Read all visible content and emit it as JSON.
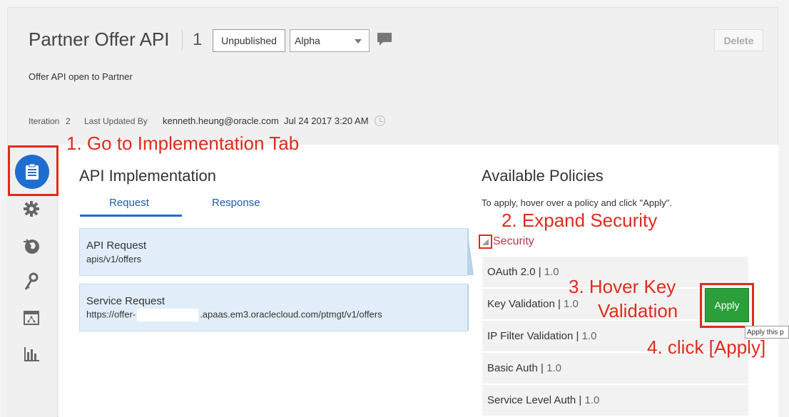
{
  "header": {
    "title": "Partner Offer API",
    "version": "1",
    "status_button": "Unpublished",
    "stage_select": "Alpha",
    "delete_label": "Delete",
    "description": "Offer API open to Partner",
    "iteration_label": "Iteration",
    "iteration_value": "2",
    "last_updated_label": "Last Updated By",
    "last_updated_by": "kenneth.heung@oracle.com",
    "last_updated_at": "Jul 24 2017 3:20 AM"
  },
  "nav": {
    "icons": [
      "implementation-icon",
      "settings-icon",
      "deploy-icon",
      "keys-icon",
      "grants-icon",
      "analytics-icon"
    ],
    "active_color": "#1f6ecf"
  },
  "implementation": {
    "heading": "API Implementation",
    "tabs": [
      {
        "label": "Request",
        "active": true
      },
      {
        "label": "Response",
        "active": false
      }
    ],
    "cards": [
      {
        "title": "API Request",
        "subtitle": "apis/v1/offers"
      },
      {
        "title": "Service Request",
        "subtitle_prefix": "https://offer-",
        "subtitle_suffix": ".apaas.em3.oraclecloud.com/ptmgt/v1/offers"
      }
    ]
  },
  "policies": {
    "heading": "Available Policies",
    "hint": "To apply, hover over a policy and click \"Apply\".",
    "group": "Security",
    "items": [
      {
        "name": "OAuth 2.0",
        "version": "1.0"
      },
      {
        "name": "Key Validation",
        "version": "1.0"
      },
      {
        "name": "IP Filter Validation",
        "version": "1.0"
      },
      {
        "name": "Basic Auth",
        "version": "1.0"
      },
      {
        "name": "Service Level Auth",
        "version": "1.0"
      }
    ],
    "apply_label": "Apply",
    "tooltip": "Apply this p"
  },
  "annotations": {
    "step1": "1. Go to Implementation Tab",
    "step2": "2. Expand Security",
    "step3_line1": "3. Hover Key",
    "step3_line2": "Validation",
    "step4": "4. click [Apply]",
    "color": "#e02b1d"
  }
}
